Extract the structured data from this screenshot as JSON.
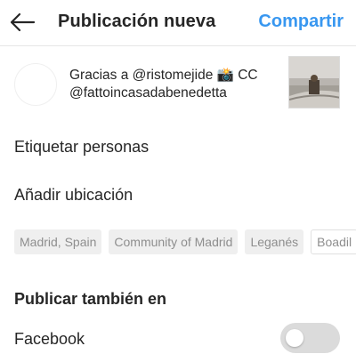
{
  "header": {
    "back_icon": "arrow-left-icon",
    "title": "Publicación nueva",
    "share_label": "Compartir",
    "share_color": "#3897f0"
  },
  "post": {
    "caption_line1": "Gracias a @ristomejide 📸 CC",
    "caption_line2": "@fattoincasadabenedetta"
  },
  "menu": {
    "tag_people": "Etiquetar personas",
    "add_location": "Añadir ubicación"
  },
  "location_suggestions": [
    "Madrid, Spain",
    "Community of Madrid",
    "Leganés",
    "Boadil"
  ],
  "share_section": {
    "title": "Publicar también en",
    "facebook_label": "Facebook",
    "facebook_enabled": false
  }
}
